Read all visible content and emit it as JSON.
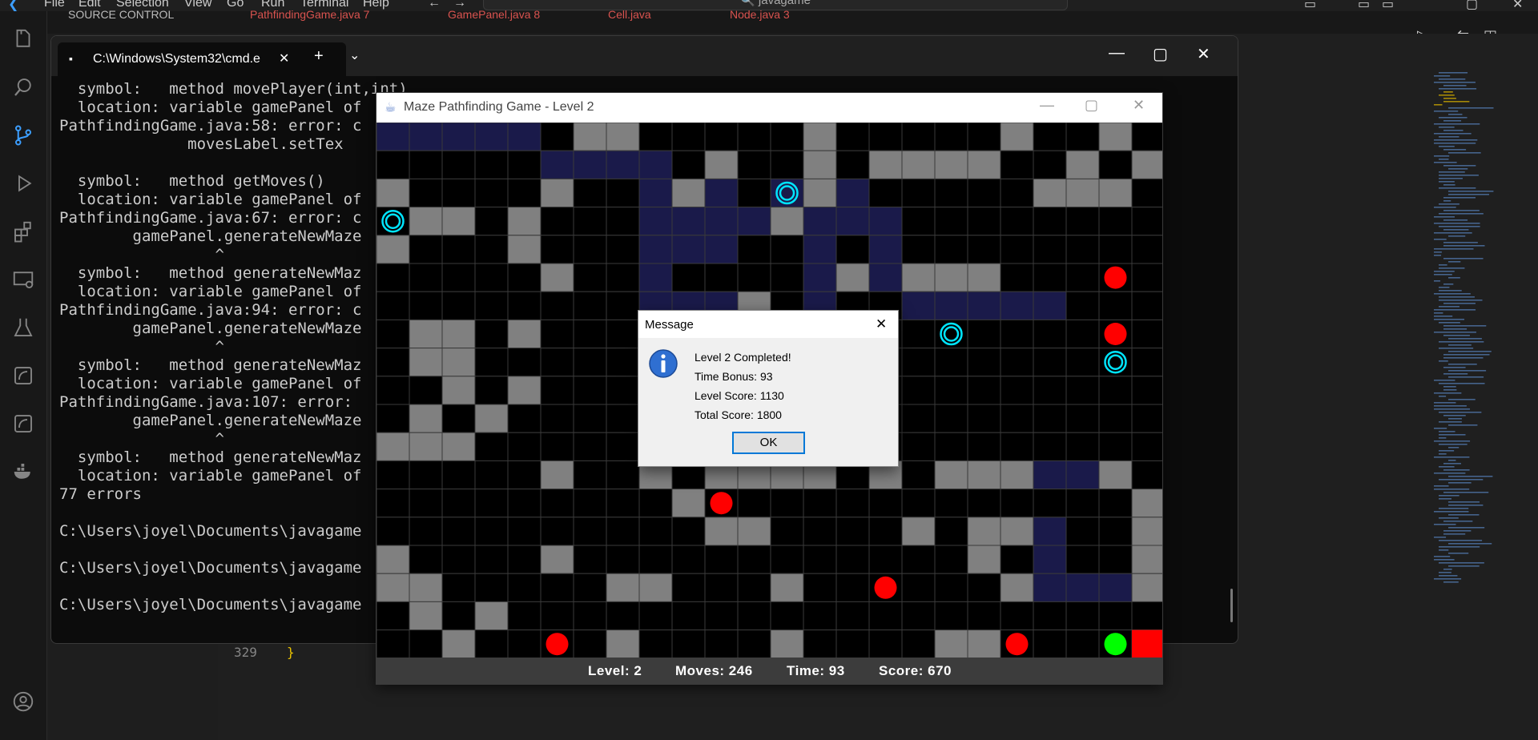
{
  "vscode": {
    "menu": [
      "File",
      "Edit",
      "Selection",
      "View",
      "Go",
      "Run",
      "Terminal",
      "Help"
    ],
    "search_text": "javagame",
    "tabs": [
      "PathfindingGame.java 7",
      "GamePanel.java 8",
      "Cell.java",
      "Node.java 3"
    ],
    "panel_label": "SOURCE CONTROL",
    "line_number": "329",
    "line_code": "}"
  },
  "terminal": {
    "tab_title": "C:\\Windows\\System32\\cmd.e",
    "lines": [
      "  symbol:   method movePlayer(int,int)",
      "  location: variable gamePanel of",
      "PathfindingGame.java:58: error: c",
      "              movesLabel.setTex",
      "",
      "  symbol:   method getMoves()",
      "  location: variable gamePanel of",
      "PathfindingGame.java:67: error: c",
      "        gamePanel.generateNewMaze",
      "                 ^",
      "  symbol:   method generateNewMaz",
      "  location: variable gamePanel of",
      "PathfindingGame.java:94: error: c",
      "        gamePanel.generateNewMaze",
      "                 ^",
      "  symbol:   method generateNewMaz",
      "  location: variable gamePanel of",
      "PathfindingGame.java:107: error:",
      "        gamePanel.generateNewMaze",
      "                 ^",
      "  symbol:   method generateNewMaz",
      "  location: variable gamePanel of",
      "77 errors",
      "",
      "C:\\Users\\joyel\\Documents\\javagame",
      "",
      "C:\\Users\\joyel\\Documents\\javagame",
      "",
      "C:\\Users\\joyel\\Documents\\javagame"
    ]
  },
  "game": {
    "title": "Maze Pathfinding Game - Level 2",
    "status": {
      "level": "Level: 2",
      "moves": "Moves: 246",
      "time": "Time: 93",
      "score": "Score: 670"
    },
    "colors": {
      "wall": "#808080",
      "floor": "#000000",
      "path": "#1a1a4a",
      "grid": "#3a3a3a",
      "enemy": "#ff0000",
      "portal": "#00e5ff",
      "player": "#00ff00",
      "goal": "#ff0000"
    },
    "maze_rows": [
      "PPPPP.##.....#.....#..#.....",
      ".....PPPP.#..#.####..#.#....",
      "#....#..P#PAP#P.....###.....",
      "A##.#...PPPP#PPP.........#..",
      "#...#...PPP..P.P...........#",
      ".....#..P....P#P###.......E#",
      "........PPP#.P..PPPPP.......",
      ".##.#........................",
      ".##..........................",
      "..#.#......................E#",
      ".#.#........................",
      "###..........................",
      ".....#..#.####.#.###PP#..##..",
      ".........#.E...........#..#..",
      "..........##....#.##P..#...#",
      "#....#............#.P..#...#",
      "##.....##...#......#PPP##....",
      ".#.#.........................",
      "..#..E.#....#....##..E.PPG"
    ],
    "entities": [
      {
        "type": "portal",
        "row": 2,
        "col": 12
      },
      {
        "type": "portal",
        "row": 3,
        "col": 0
      },
      {
        "type": "portal",
        "row": 7,
        "col": 17
      },
      {
        "type": "portal",
        "row": 8,
        "col": 22
      },
      {
        "type": "enemy",
        "row": 5,
        "col": 22
      },
      {
        "type": "enemy",
        "row": 7,
        "col": 22
      },
      {
        "type": "enemy",
        "row": 13,
        "col": 10
      },
      {
        "type": "enemy",
        "row": 16,
        "col": 15
      },
      {
        "type": "enemy",
        "row": 18,
        "col": 5
      },
      {
        "type": "enemy",
        "row": 18,
        "col": 19
      },
      {
        "type": "player",
        "row": 18,
        "col": 22
      },
      {
        "type": "goal",
        "row": 18,
        "col": 23
      }
    ]
  },
  "dialog": {
    "title": "Message",
    "lines": [
      "Level 2 Completed!",
      "Time Bonus: 93",
      "Level Score: 1130",
      "Total Score: 1800"
    ],
    "ok_label": "OK",
    "icon": "info-icon"
  }
}
